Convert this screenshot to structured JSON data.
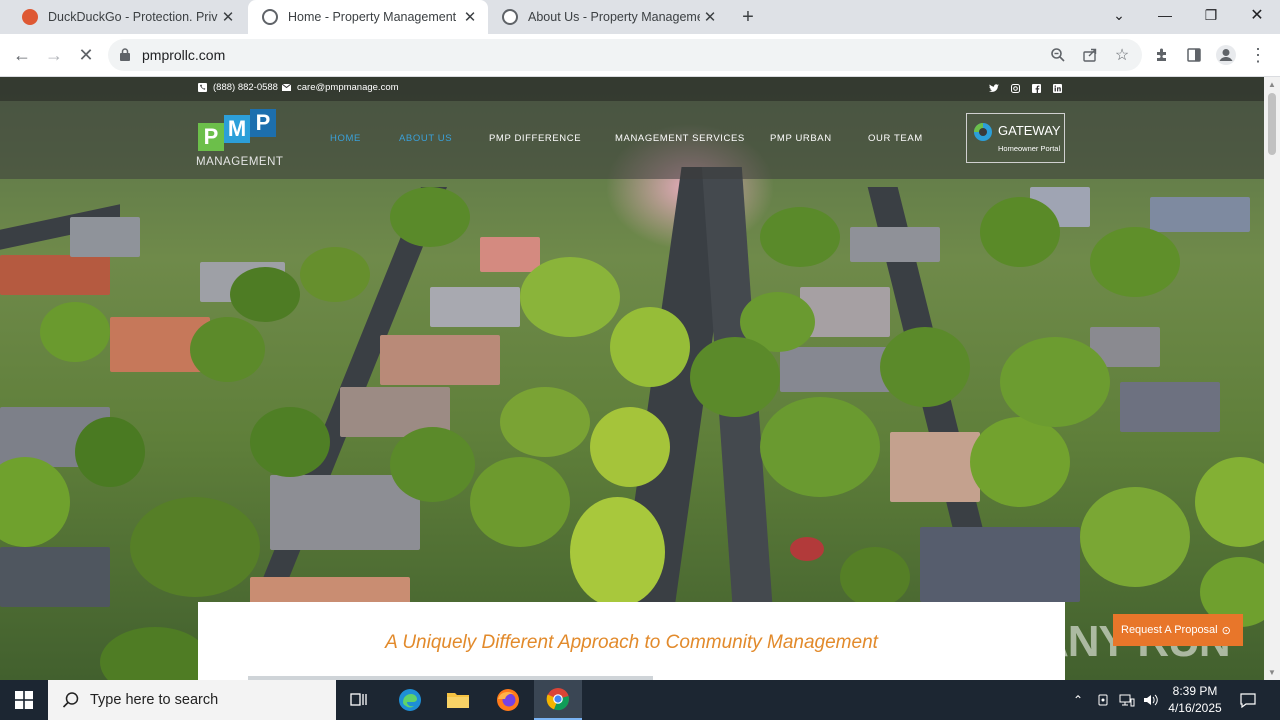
{
  "browser": {
    "tabs": [
      {
        "title": "DuckDuckGo - Protection. Privacy. Peace of mind.",
        "active": false
      },
      {
        "title": "Home - Property Management Professionals",
        "active": true
      },
      {
        "title": "About Us - Property Management Professionals",
        "active": false
      }
    ],
    "address": "pmprollc.com"
  },
  "site": {
    "phone": "(888) 882-0588",
    "email": "care@pmpmanage.com",
    "social": [
      "twitter-icon",
      "instagram-icon",
      "facebook-icon",
      "linkedin-icon"
    ],
    "logo": {
      "letters": [
        "P",
        "M",
        "P"
      ],
      "subtitle": "MANAGEMENT"
    },
    "nav": [
      "HOME",
      "ABOUT US",
      "PMP DIFFERENCE",
      "MANAGEMENT SERVICES",
      "PMP URBAN",
      "OUR TEAM"
    ],
    "gateway": {
      "title": "GATEWAY",
      "subtitle": "Homeowner Portal"
    },
    "headline": "A Uniquely Different Approach to Community Management",
    "proposal_button": "Request A Proposal",
    "watermark": "ANY RUN"
  },
  "taskbar": {
    "search_placeholder": "Type here to search",
    "time": "8:39 PM",
    "date": "4/16/2025"
  },
  "colors": {
    "accent_blue": "#3aa0d8",
    "headline_orange": "#e28a2b",
    "proposal_orange": "#e8762a",
    "logo_green": "#6cbf4a",
    "logo_blue": "#2c9fd9"
  }
}
